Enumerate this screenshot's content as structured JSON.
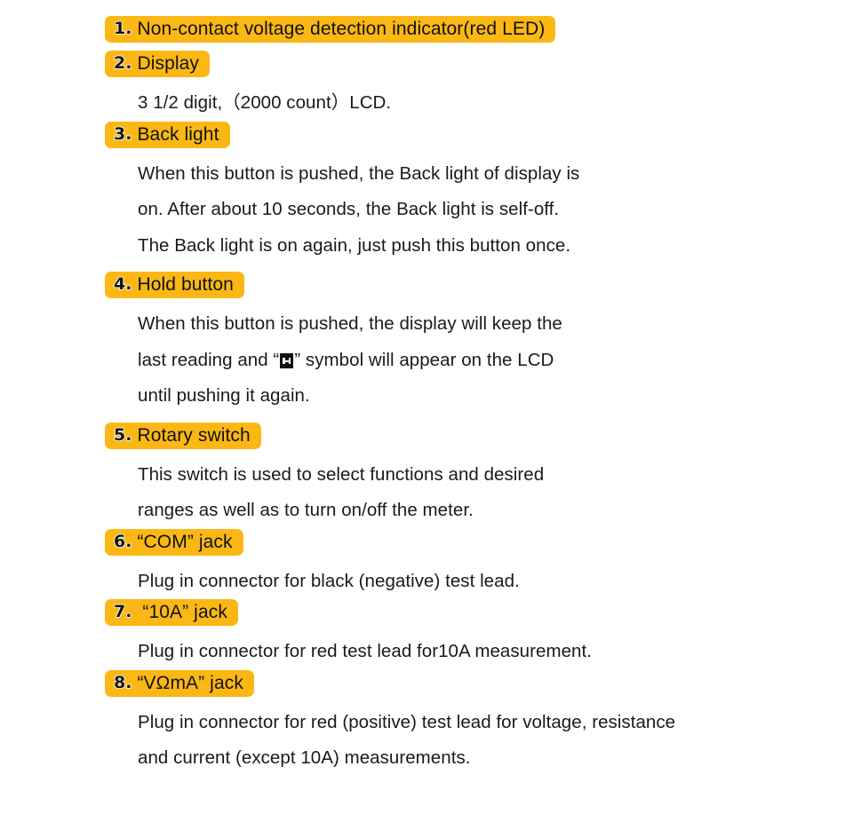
{
  "theme": {
    "highlight_color": "#FBB815",
    "text_color": "#1a1a1a",
    "background": "#ffffff"
  },
  "sections": [
    {
      "number": "1.",
      "heading": "Non-contact voltage detection indicator(red LED)",
      "body": []
    },
    {
      "number": "2.",
      "heading": "Display",
      "body": [
        "3 1/2 digit,（2000 count）LCD."
      ]
    },
    {
      "number": "3.",
      "heading": "Back light",
      "body": [
        "When this button is pushed, the Back light of display is",
        "on. After about 10 seconds, the Back light is self-off.",
        "The Back light is on again, just push this button once."
      ]
    },
    {
      "number": "4.",
      "heading": "Hold button",
      "body_parts": {
        "line1": "When this button is pushed, the display will keep the",
        "line2_before": "last reading and “",
        "line2_symbol": "hold-h-symbol",
        "line2_after": "” symbol will appear on the LCD",
        "line3": "until pushing it again."
      }
    },
    {
      "number": "5.",
      "heading": "Rotary switch",
      "body": [
        "This switch is used to select functions and desired",
        "ranges as well as to turn on/off the meter."
      ]
    },
    {
      "number": "6.",
      "heading": "“COM” jack",
      "body": [
        "Plug in connector for black (negative) test lead."
      ]
    },
    {
      "number": "7.",
      "heading": " “10A” jack",
      "body": [
        "Plug in connector for red test lead for10A measurement."
      ]
    },
    {
      "number": "8.",
      "heading": "“VΩmA” jack",
      "body": [
        "Plug in connector for red (positive) test lead for voltage, resistance",
        "and current (except 10A) measurements."
      ]
    }
  ]
}
